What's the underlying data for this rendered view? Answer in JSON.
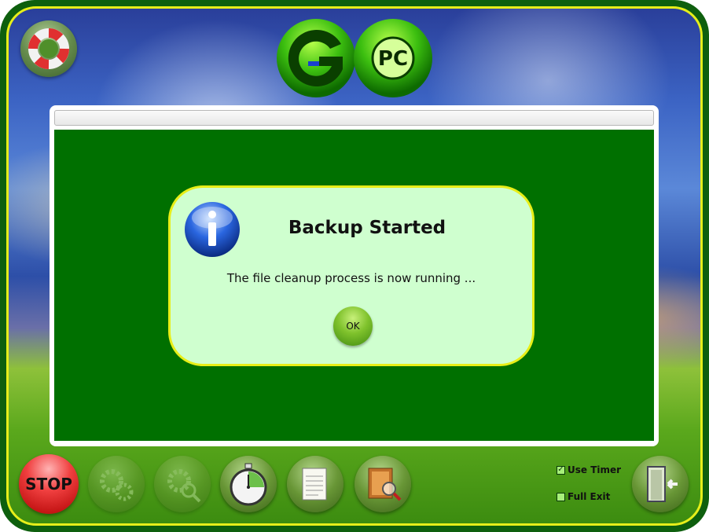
{
  "logo": {
    "letter": "G",
    "text": "PC"
  },
  "dialog": {
    "title": "Backup Started",
    "message": "The file cleanup process is now running ...",
    "ok_label": "OK",
    "icon": "info-icon"
  },
  "toolbar": {
    "stop_label": "STOP",
    "help_icon": "lifebuoy-icon",
    "buttons": [
      {
        "icon": "gears-icon",
        "enabled": false
      },
      {
        "icon": "gear-magnifier-icon",
        "enabled": false
      },
      {
        "icon": "stopwatch-icon",
        "enabled": true
      },
      {
        "icon": "notepad-icon",
        "enabled": true
      },
      {
        "icon": "book-search-icon",
        "enabled": true
      }
    ],
    "exit_icon": "exit-door-icon"
  },
  "options": {
    "use_timer_label": "Use Timer",
    "use_timer_checked": true,
    "full_exit_label": "Full Exit",
    "full_exit_checked": false
  },
  "colors": {
    "frame": "#0e5f0e",
    "frame_border": "#e6ee1a",
    "content_bg": "#007000",
    "dialog_bg": "#cfffcf",
    "dialog_border": "#e8ee18"
  }
}
